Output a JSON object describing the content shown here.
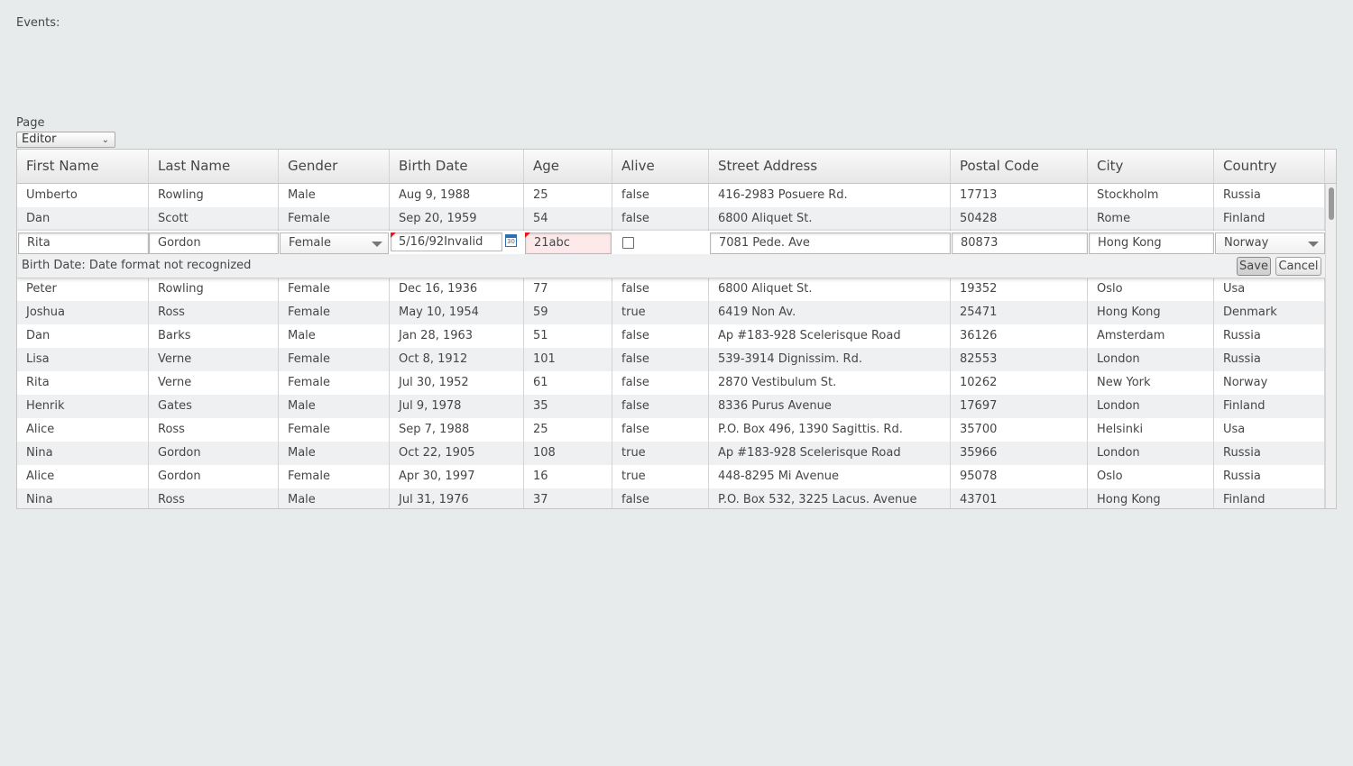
{
  "events_label": "Events:",
  "page_selector": {
    "label": "Page",
    "value": "Editor"
  },
  "grid": {
    "columns": [
      "First Name",
      "Last Name",
      "Gender",
      "Birth Date",
      "Age",
      "Alive",
      "Street Address",
      "Postal Code",
      "City",
      "Country"
    ],
    "rows_before": [
      [
        "Umberto",
        "Rowling",
        "Male",
        "Aug 9, 1988",
        "25",
        "false",
        "416-2983 Posuere Rd.",
        "17713",
        "Stockholm",
        "Russia"
      ],
      [
        "Dan",
        "Scott",
        "Female",
        "Sep 20, 1959",
        "54",
        "false",
        "6800 Aliquet St.",
        "50428",
        "Rome",
        "Finland"
      ]
    ],
    "editor": {
      "first_name": "Rita",
      "last_name": "Gordon",
      "gender": "Female",
      "birth_date": "5/16/92Invalid",
      "age": "21abc",
      "street_address": "7081 Pede. Ave",
      "postal_code": "80873",
      "city": "Hong Kong",
      "country": "Norway",
      "error_message": "Birth Date: Date format not recognized",
      "save_label": "Save",
      "cancel_label": "Cancel",
      "calendar_icon_text": "30"
    },
    "rows_after": [
      [
        "Peter",
        "Rowling",
        "Female",
        "Dec 16, 1936",
        "77",
        "false",
        "6800 Aliquet St.",
        "19352",
        "Oslo",
        "Usa"
      ],
      [
        "Joshua",
        "Ross",
        "Female",
        "May 10, 1954",
        "59",
        "true",
        "6419 Non Av.",
        "25471",
        "Hong Kong",
        "Denmark"
      ],
      [
        "Dan",
        "Barks",
        "Male",
        "Jan 28, 1963",
        "51",
        "false",
        "Ap #183-928 Scelerisque Road",
        "36126",
        "Amsterdam",
        "Russia"
      ],
      [
        "Lisa",
        "Verne",
        "Female",
        "Oct 8, 1912",
        "101",
        "false",
        "539-3914 Dignissim. Rd.",
        "82553",
        "London",
        "Russia"
      ],
      [
        "Rita",
        "Verne",
        "Female",
        "Jul 30, 1952",
        "61",
        "false",
        "2870 Vestibulum St.",
        "10262",
        "New York",
        "Norway"
      ],
      [
        "Henrik",
        "Gates",
        "Male",
        "Jul 9, 1978",
        "35",
        "false",
        "8336 Purus Avenue",
        "17697",
        "London",
        "Finland"
      ],
      [
        "Alice",
        "Ross",
        "Female",
        "Sep 7, 1988",
        "25",
        "false",
        "P.O. Box 496, 1390 Sagittis. Rd.",
        "35700",
        "Helsinki",
        "Usa"
      ],
      [
        "Nina",
        "Gordon",
        "Male",
        "Oct 22, 1905",
        "108",
        "true",
        "Ap #183-928 Scelerisque Road",
        "35966",
        "London",
        "Russia"
      ],
      [
        "Alice",
        "Gordon",
        "Female",
        "Apr 30, 1997",
        "16",
        "true",
        "448-8295 Mi Avenue",
        "95078",
        "Oslo",
        "Russia"
      ],
      [
        "Nina",
        "Ross",
        "Male",
        "Jul 31, 1976",
        "37",
        "false",
        "P.O. Box 532, 3225 Lacus. Avenue",
        "43701",
        "Hong Kong",
        "Finland"
      ]
    ]
  }
}
